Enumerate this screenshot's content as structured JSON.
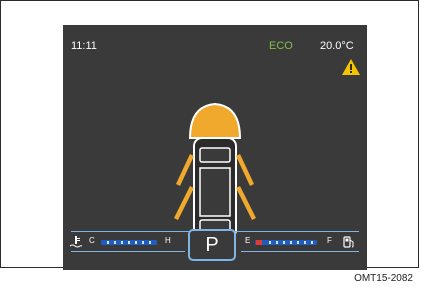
{
  "cluster": {
    "time": "11:11",
    "drive_mode": "ECO",
    "outside_temp": "20.0°C",
    "warning_icon": "triangle-warning-icon",
    "gear": "P",
    "coolant_gauge": {
      "low_label": "C",
      "high_label": "H",
      "icon": "coolant-temp-icon"
    },
    "fuel_gauge": {
      "low_label": "E",
      "high_label": "F",
      "icon": "fuel-pump-icon",
      "level_segments_red": 1
    },
    "colors": {
      "eco": "#7cc242",
      "warning": "#f6c300",
      "door_open": "#f0a92c",
      "gauge_bar": "#1e5dbf",
      "outline": "#7fb4e6"
    }
  },
  "figure_code": "OMT15-2082"
}
